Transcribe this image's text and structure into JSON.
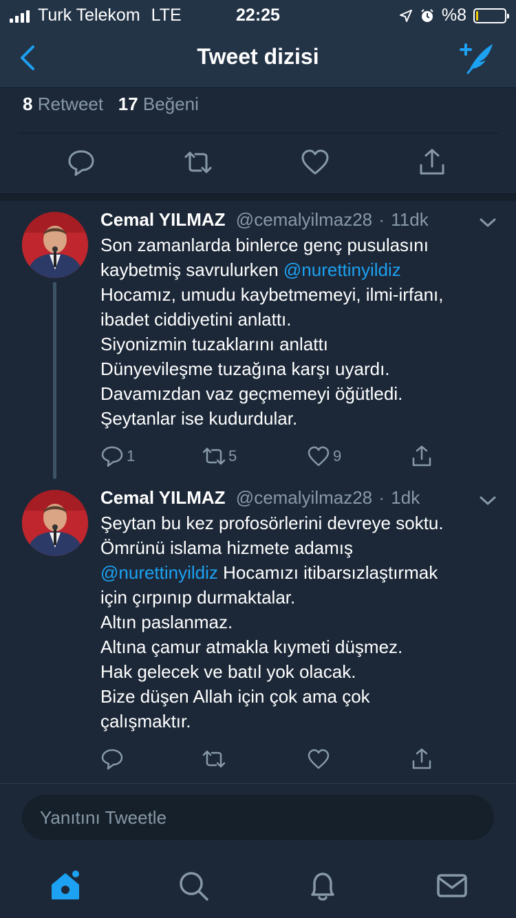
{
  "status_bar": {
    "carrier": "Turk Telekom",
    "network": "LTE",
    "time": "22:25",
    "battery": "%8",
    "battery_level": 0.08,
    "battery_color": "#f7c800"
  },
  "nav": {
    "title": "Tweet dizisi",
    "back_icon": "chevron-left-icon",
    "compose_icon": "compose-tweet-icon"
  },
  "stats": {
    "retweet_count": "8",
    "retweet_label": "Retweet",
    "like_count": "17",
    "like_label": "Beğeni"
  },
  "tweets": [
    {
      "name": "Cemal YILMAZ",
      "handle": "@cemalyilmaz28",
      "sep": "·",
      "time": "11dk",
      "lines": [
        {
          "text": "Son zamanlarda binlerce genç pusulasını"
        },
        {
          "text": "kaybetmiş savrulurken ",
          "mention": "@nurettinyildiz"
        },
        {
          "text": "Hocamız, umudu kaybetmemeyi, ilmi-irfanı,"
        },
        {
          "text": "ibadet ciddiyetini anlattı."
        },
        {
          "text": "Siyonizmin tuzaklarını anlattı"
        },
        {
          "text": "Dünyevileşme tuzağına karşı uyardı."
        },
        {
          "text": "Davamızdan vaz geçmemeyi öğütledi."
        },
        {
          "text": "Şeytanlar ise  kudurdular."
        }
      ],
      "reply_count": "1",
      "retweet_count": "5",
      "like_count": "9"
    },
    {
      "name": "Cemal YILMAZ",
      "handle": "@cemalyilmaz28",
      "sep": "·",
      "time": "1dk",
      "lines": [
        {
          "text": "Şeytan bu kez profosörlerini devreye soktu."
        },
        {
          "text": "Ömrünü islama hizmete adamış"
        },
        {
          "mention": "@nurettinyildiz",
          "after": " Hocamızı itibarsızlaştırmak"
        },
        {
          "text": "için çırpınıp durmaktalar."
        },
        {
          "text": "Altın paslanmaz."
        },
        {
          "text": "Altına çamur atmakla kıymeti düşmez."
        },
        {
          "text": "Hak gelecek ve batıl yok olacak."
        },
        {
          "text": "Bize düşen  Allah için çok ama çok"
        },
        {
          "text": "çalışmaktır."
        }
      ],
      "reply_count": "",
      "retweet_count": "",
      "like_count": ""
    }
  ],
  "reply": {
    "placeholder": "Yanıtını Tweetle"
  },
  "tabs": [
    {
      "name": "home-icon",
      "active": true
    },
    {
      "name": "search-icon",
      "active": false
    },
    {
      "name": "notifications-bell-icon",
      "active": false
    },
    {
      "name": "messages-envelope-icon",
      "active": false
    }
  ],
  "colors": {
    "background": "#1c2838",
    "bar": "#243447",
    "accent": "#1da1f2",
    "muted": "#8899a6"
  }
}
